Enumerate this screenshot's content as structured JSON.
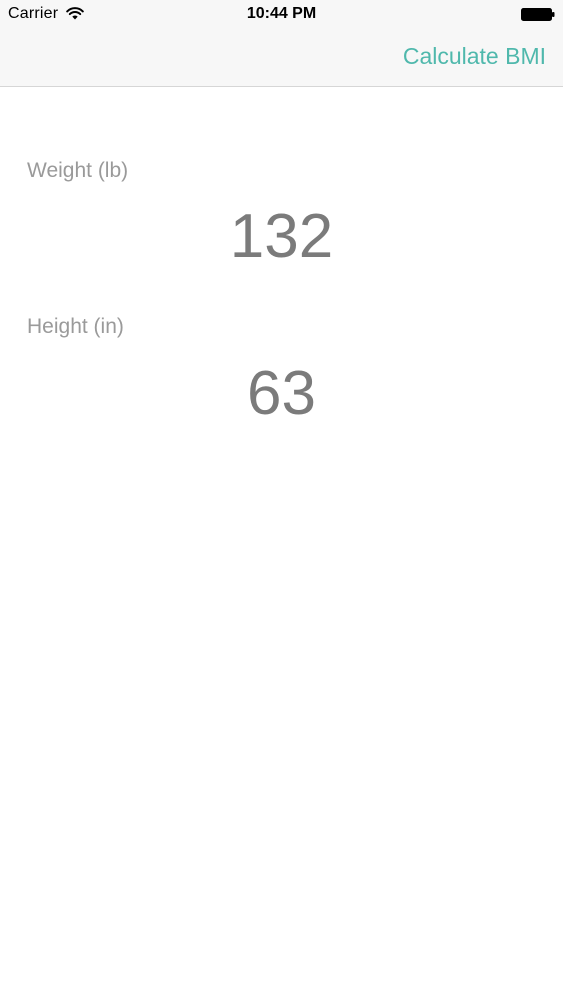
{
  "status_bar": {
    "carrier": "Carrier",
    "time": "10:44 PM",
    "wifi_icon": "wifi-icon",
    "battery_icon": "battery-icon"
  },
  "nav": {
    "action_label": "Calculate BMI",
    "accent_color": "#4fb8ac"
  },
  "form": {
    "weight_label": "Weight (lb)",
    "weight_value": "132",
    "height_label": "Height (in)",
    "height_value": "63"
  }
}
